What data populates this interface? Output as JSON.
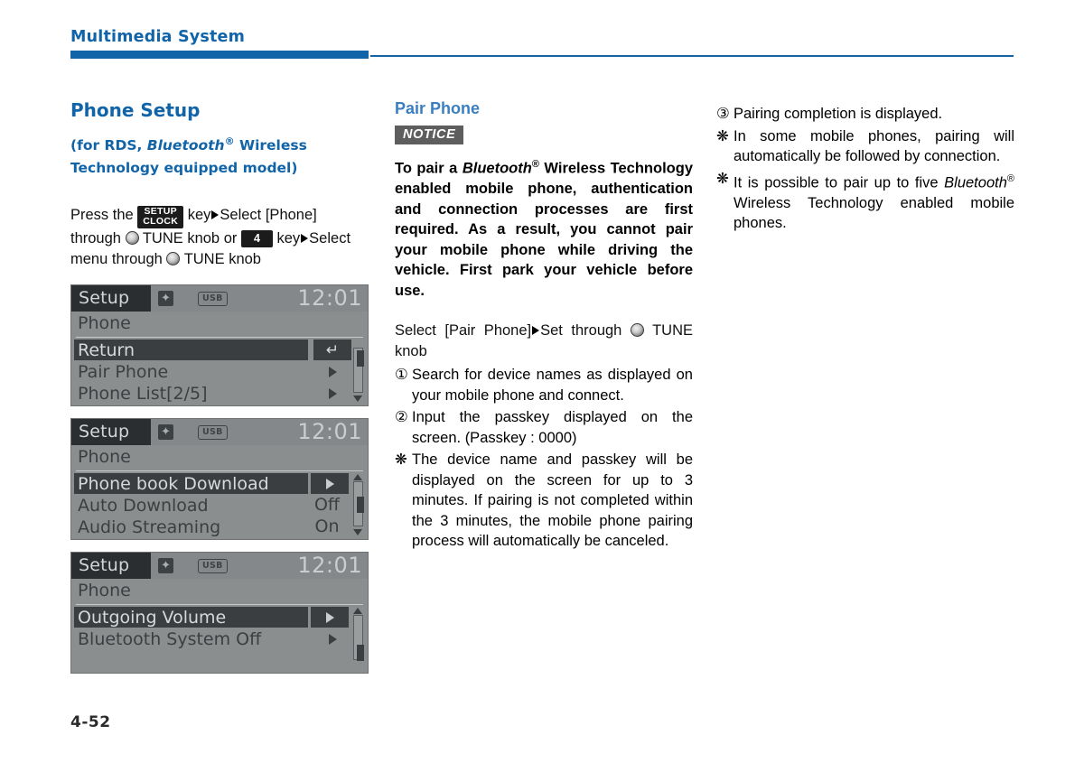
{
  "header": {
    "title": "Multimedia System"
  },
  "footer": {
    "page_number": "4-52"
  },
  "colors": {
    "brand_blue": "#1164a8",
    "heading_blue": "#3a7fc1",
    "notice_gray": "#5e5e5e",
    "lcd_background": "#8b8e8e",
    "lcd_dark": "#3a3e40"
  },
  "left_column": {
    "heading": "Phone Setup",
    "subheading_prefix": "(for RDS, ",
    "subheading_bluetooth": "Bluetooth",
    "subheading_reg": "®",
    "subheading_suffix": " Wireless Technology equipped model)",
    "instruction": {
      "t1": "Press the ",
      "key_setup_line1": "SETUP",
      "key_setup_line2": "CLOCK",
      "t2": " key",
      "t3": "Select [Phone] through ",
      "knob1": "tune-knob",
      "t4": " TUNE knob or ",
      "key_num": "4",
      "t5": " key",
      "t6": "Select menu through ",
      "knob2": "tune-knob",
      "t7": " TUNE knob"
    },
    "lcd_screens": [
      {
        "title": "Setup",
        "bt_icon": "bluetooth-icon",
        "usb_label": "USB",
        "clock": "12:01",
        "subtitle": "Phone",
        "rows": [
          {
            "label": "Return",
            "selected": true,
            "right_type": "return-boxed",
            "value": ""
          },
          {
            "label": "Pair Phone",
            "selected": false,
            "right_type": "arrow",
            "value": ""
          },
          {
            "label": "Phone List[2/5]",
            "selected": false,
            "right_type": "arrow",
            "value": ""
          }
        ],
        "scroll": {
          "thumb_top_pct": 4,
          "thumb_height_pct": 34,
          "up_arrow": false,
          "down_arrow": true
        }
      },
      {
        "title": "Setup",
        "bt_icon": "bluetooth-icon",
        "usb_label": "USB",
        "clock": "12:01",
        "subtitle": "Phone",
        "rows": [
          {
            "label": "Phone book Download",
            "selected": true,
            "right_type": "arrow-boxed",
            "value": ""
          },
          {
            "label": "Auto Download",
            "selected": false,
            "right_type": "value",
            "value": "Off"
          },
          {
            "label": "Audio Streaming",
            "selected": false,
            "right_type": "value",
            "value": "On"
          }
        ],
        "scroll": {
          "thumb_top_pct": 36,
          "thumb_height_pct": 34,
          "up_arrow": true,
          "down_arrow": true
        }
      },
      {
        "title": "Setup",
        "bt_icon": "bluetooth-icon",
        "usb_label": "USB",
        "clock": "12:01",
        "subtitle": "Phone",
        "rows": [
          {
            "label": "Outgoing Volume",
            "selected": true,
            "right_type": "arrow-boxed",
            "value": ""
          },
          {
            "label": "Bluetooth System Off",
            "selected": false,
            "right_type": "arrow",
            "value": ""
          }
        ],
        "scroll": {
          "thumb_top_pct": 62,
          "thumb_height_pct": 34,
          "up_arrow": true,
          "down_arrow": false
        }
      }
    ]
  },
  "middle_column": {
    "heading": "Pair Phone",
    "notice_badge": "NOTICE",
    "notice_p1": "To pair a ",
    "notice_bt": "Bluetooth",
    "notice_reg": "®",
    "notice_p2": " Wireless Technology enabled mobile phone, authentication and connection processes are first required. As a result, you cannot pair your mobile phone while driving the vehicle. First park your vehicle before use.",
    "instruction": {
      "t1": "Select [Pair Phone]",
      "t2": "Set through ",
      "knob": "tune-knob",
      "t3": " TUNE knob"
    },
    "items": [
      {
        "mark": "①",
        "text": "Search for device names as displayed on your mobile phone and connect."
      },
      {
        "mark": "②",
        "text": "Input the passkey displayed on the screen. (Passkey : 0000)"
      },
      {
        "mark": "❋",
        "text": "The device name and passkey will be displayed on the screen for up to 3 minutes. If pairing is not completed within the 3 minutes, the mobile phone pairing process will automatically be canceled."
      }
    ]
  },
  "right_column": {
    "items": [
      {
        "mark": "③",
        "text": "Pairing completion is displayed."
      },
      {
        "mark": "❋",
        "text": "In some mobile phones, pairing will automatically be followed by connection."
      }
    ],
    "last_item": {
      "mark": "❋",
      "t1": "It is possible to pair up to five ",
      "bt": "Bluetooth",
      "reg": "®",
      "t2": " Wireless Technology enabled mobile phones."
    }
  }
}
